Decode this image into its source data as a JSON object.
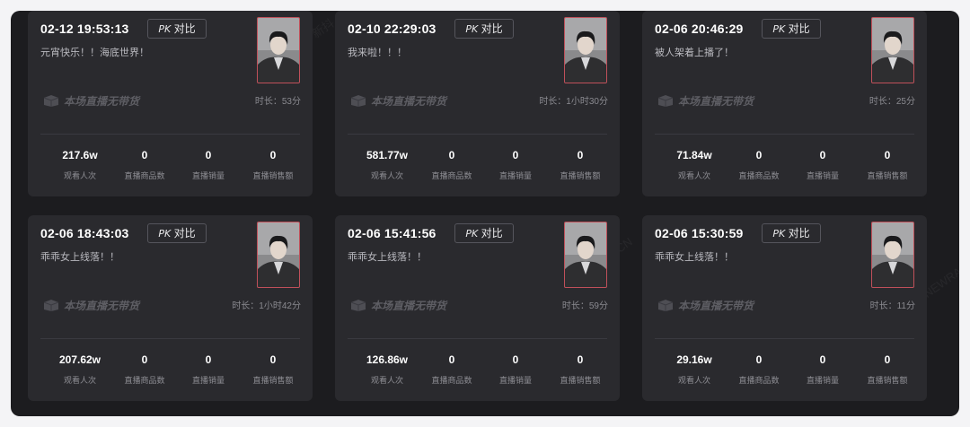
{
  "pk_label": "PK",
  "pk_suffix": "对比",
  "badge_text": "本场直播无带货",
  "stat_labels": [
    "观看人次",
    "直播商品数",
    "直播销量",
    "直播销售额"
  ],
  "watermark": "XD.NEWRANK.CN",
  "watermark2": "新榜 · 新抖",
  "cards": [
    {
      "time": "02-12 19:53:13",
      "title": "元宵快乐！！海底世界！",
      "duration": "时长：53分",
      "stats": [
        "217.6w",
        "0",
        "0",
        "0"
      ]
    },
    {
      "time": "02-10 22:29:03",
      "title": "我来啦！！！",
      "duration": "时长：1小时30分",
      "stats": [
        "581.77w",
        "0",
        "0",
        "0"
      ]
    },
    {
      "time": "02-06 20:46:29",
      "title": "被人架着上播了！",
      "duration": "时长：25分",
      "stats": [
        "71.84w",
        "0",
        "0",
        "0"
      ]
    },
    {
      "time": "02-06 18:43:03",
      "title": "乖乖女上线落！！",
      "duration": "时长：1小时42分",
      "stats": [
        "207.62w",
        "0",
        "0",
        "0"
      ]
    },
    {
      "time": "02-06 15:41:56",
      "title": "乖乖女上线落！！",
      "duration": "时长：59分",
      "stats": [
        "126.86w",
        "0",
        "0",
        "0"
      ]
    },
    {
      "time": "02-06 15:30:59",
      "title": "乖乖女上线落！！",
      "duration": "时长：11分",
      "stats": [
        "29.16w",
        "0",
        "0",
        "0"
      ]
    }
  ]
}
